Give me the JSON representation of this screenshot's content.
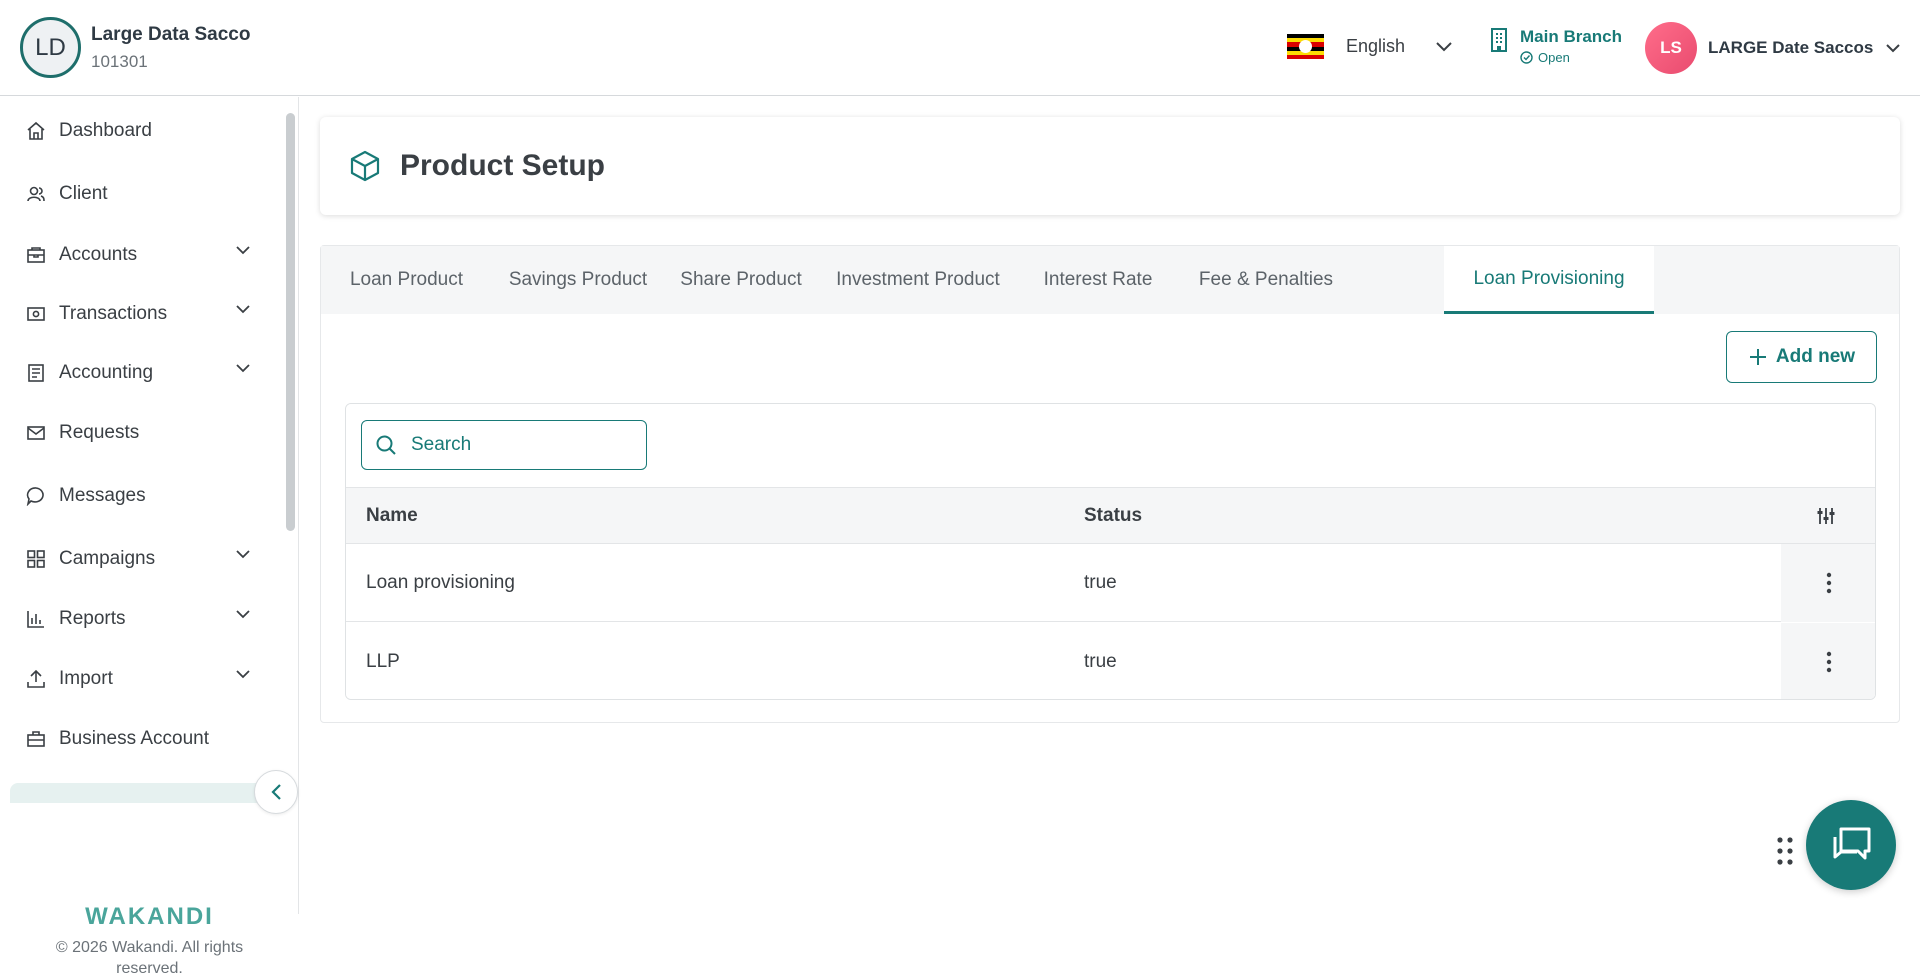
{
  "org": {
    "initials": "LD",
    "name": "Large Data Sacco",
    "code": "101301"
  },
  "language": {
    "label": "English",
    "flag_icon": "uganda-flag-icon"
  },
  "branch": {
    "name": "Main Branch",
    "status": "Open"
  },
  "user": {
    "initials": "LS",
    "name": "LARGE Date Saccos"
  },
  "sidebar": {
    "items": [
      {
        "label": "Dashboard",
        "icon": "home-icon",
        "expandable": false
      },
      {
        "label": "Client",
        "icon": "users-icon",
        "expandable": false
      },
      {
        "label": "Accounts",
        "icon": "accounts-icon",
        "expandable": true
      },
      {
        "label": "Transactions",
        "icon": "cash-icon",
        "expandable": true
      },
      {
        "label": "Accounting",
        "icon": "ledger-icon",
        "expandable": true
      },
      {
        "label": "Requests",
        "icon": "mail-icon",
        "expandable": false
      },
      {
        "label": "Messages",
        "icon": "chat-icon",
        "expandable": false
      },
      {
        "label": "Campaigns",
        "icon": "grid-icon",
        "expandable": true
      },
      {
        "label": "Reports",
        "icon": "bar-chart-icon",
        "expandable": true
      },
      {
        "label": "Import",
        "icon": "upload-icon",
        "expandable": true
      },
      {
        "label": "Business Account",
        "icon": "briefcase-icon",
        "expandable": false
      }
    ],
    "brand": "WAKANDI",
    "copyright": "© 2026 Wakandi. All rights reserved."
  },
  "page": {
    "title": "Product Setup",
    "icon": "cube-icon"
  },
  "tabs": [
    {
      "label": "Loan Product",
      "active": false
    },
    {
      "label": "Savings Product",
      "active": false
    },
    {
      "label": "Share Product",
      "active": false
    },
    {
      "label": "Investment Product",
      "active": false
    },
    {
      "label": "Interest Rate",
      "active": false
    },
    {
      "label": "Fee & Penalties",
      "active": false
    },
    {
      "label": "Loan Provisioning",
      "active": true
    }
  ],
  "toolbar": {
    "add_label": "Add new"
  },
  "search": {
    "placeholder": "Search"
  },
  "table": {
    "columns": [
      "Name",
      "Status"
    ],
    "rows": [
      {
        "name": "Loan provisioning",
        "status": "true"
      },
      {
        "name": "LLP",
        "status": "true"
      }
    ]
  },
  "colors": {
    "accent": "#187a77",
    "avatar": "#ef5a7b",
    "brand": "#4aa59b"
  }
}
